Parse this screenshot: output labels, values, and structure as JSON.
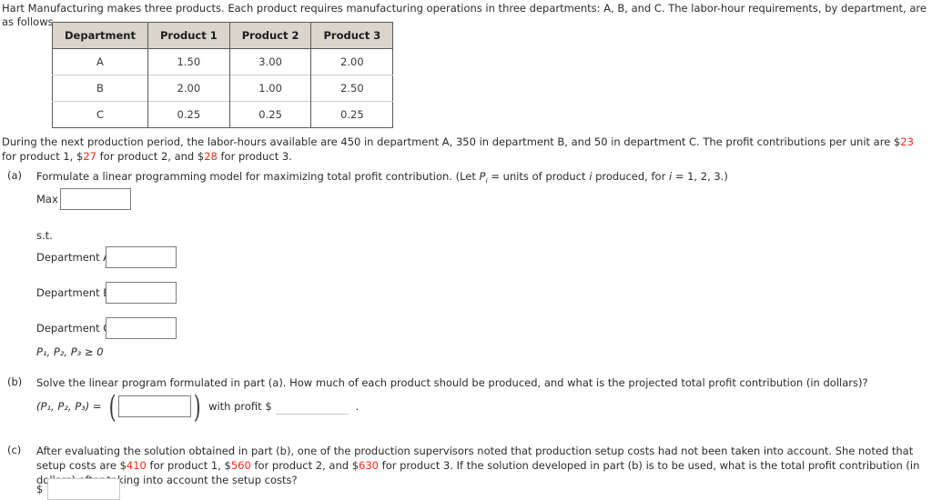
{
  "intro": "Hart Manufacturing makes three products. Each product requires manufacturing operations in three departments: A, B, and C. The labor-hour requirements, by department, are as follows.",
  "table": {
    "headers": [
      "Department",
      "Product 1",
      "Product 2",
      "Product 3"
    ],
    "rows": [
      {
        "dept": "A",
        "p1": "1.50",
        "p2": "3.00",
        "p3": "2.00"
      },
      {
        "dept": "B",
        "p1": "2.00",
        "p2": "1.00",
        "p3": "2.50"
      },
      {
        "dept": "C",
        "p1": "0.25",
        "p2": "0.25",
        "p3": "0.25"
      }
    ]
  },
  "during": {
    "t1": "During the next production period, the labor-hours available are 450 in department A, 350 in department B, and 50 in department C. The profit contributions per unit are $",
    "v1": "23",
    "t2": " for product 1, $",
    "v2": "27",
    "t3": " for product 2, and $",
    "v3": "28",
    "t4": " for product 3."
  },
  "part_a": {
    "label": "(a)",
    "text_1": "Formulate a linear programming model for maximizing total profit contribution. (Let ",
    "var_p": "P",
    "sub_i": "i",
    "text_2": " = units of product ",
    "var_i": "i",
    "text_3": " produced, for ",
    "var_i2": "i",
    "text_4": " = 1, 2, 3.)",
    "max_label": "Max",
    "st_label": "s.t.",
    "constraints": [
      {
        "label": "Department A",
        "value": "",
        "placeholder": ""
      },
      {
        "label": "Department B",
        "value": "",
        "placeholder": ""
      },
      {
        "label": "Department C",
        "value": "",
        "placeholder": ""
      }
    ],
    "objective_value": "",
    "nonneg": "P₁, P₂, P₃ ≥ 0"
  },
  "part_b": {
    "label": "(b)",
    "text": "Solve the linear program formulated in part (a). How much of each product should be produced, and what is the projected total profit contribution (in dollars)?",
    "tuple_label": "(P₁, P₂, P₃) =",
    "open_paren": "(",
    "close_paren": ")",
    "tuple_value": "",
    "with_profit": "with profit $",
    "profit_value": "",
    "period": "."
  },
  "part_c": {
    "label": "(c)",
    "t1": "After evaluating the solution obtained in part (b), one of the production supervisors noted that production setup costs had not been taken into account. She noted that setup costs are $",
    "v1": "410",
    "t2": " for product 1, $",
    "v2": "560",
    "t3": " for product 2, and $",
    "v3": "630",
    "t4": " for product 3. If the solution developed in part (b) is to be used, what is the total profit contribution (in dollars) after taking into account the setup costs?",
    "dollar": "$",
    "answer_value": ""
  },
  "colors": {
    "highlight_red": "#ee2b15",
    "table_header_bg": "#d9d5cc",
    "table_border": "#5a5a5a",
    "input_border": "#7c7c7c"
  }
}
